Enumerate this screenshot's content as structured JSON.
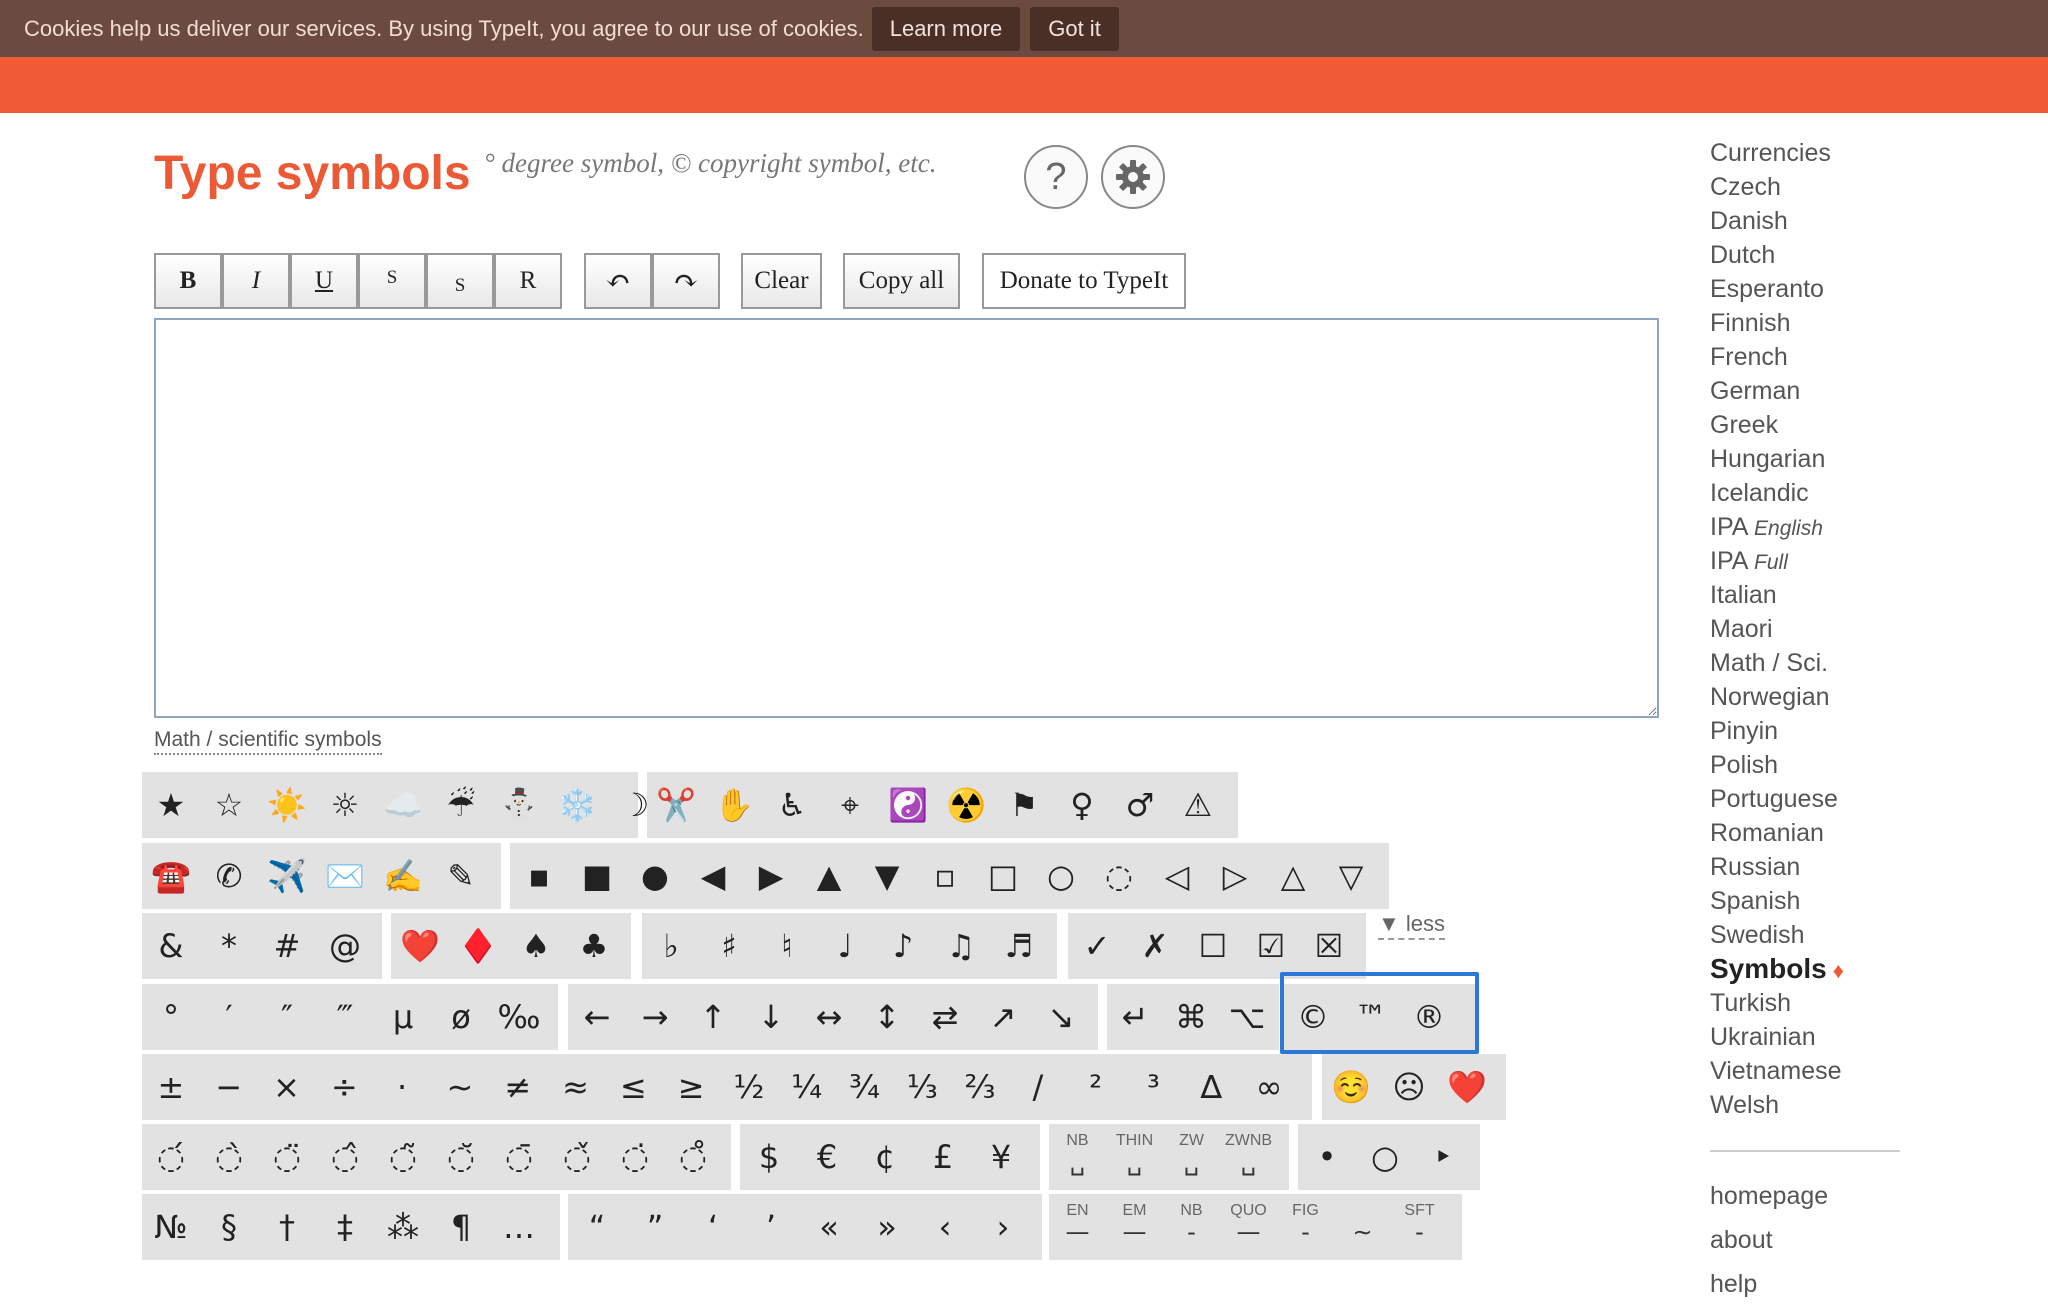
{
  "cookie": {
    "text": "Cookies help us deliver our services. By using TypeIt, you agree to our use of cookies.",
    "learn_more": "Learn more",
    "got_it": "Got it"
  },
  "header": {
    "title": "Type symbols",
    "subtitle": "° degree symbol, © copyright symbol, etc.",
    "help_label": "?",
    "settings_label": "⚙"
  },
  "toolbar": {
    "bold": "B",
    "italic": "I",
    "underline": "U",
    "superscript": "S",
    "subscript": "S",
    "reset": "R",
    "undo": "↶",
    "redo": "↷",
    "clear": "Clear",
    "copy_all": "Copy all",
    "donate": "Donate to TypeIt"
  },
  "editor": {
    "value": ""
  },
  "section": {
    "label": "Math / scientific symbols",
    "less": "▼ less"
  },
  "keyboard": {
    "row1a": [
      "★",
      "☆",
      "☀️",
      "☼",
      "☁️",
      "☔",
      "⛄",
      "❄️",
      "☽"
    ],
    "row1b": [
      "✂️",
      "✋",
      "♿",
      "⌖",
      "☯️",
      "☢️",
      "⚑",
      "♀",
      "♂",
      "⚠"
    ],
    "row2a": [
      "☎️",
      "✆",
      "✈️",
      "✉️",
      "✍️",
      "✎"
    ],
    "row2b": [
      "▪",
      "■",
      "●",
      "◀",
      "▶",
      "▲",
      "▼",
      "▫",
      "□",
      "○",
      "◌",
      "◁",
      "▷",
      "△",
      "▽"
    ],
    "row3a": [
      "&",
      "*",
      "#",
      "@"
    ],
    "row3b": [
      "❤️",
      "♦️",
      "♠",
      "♣"
    ],
    "row3c": [
      "♭",
      "♯",
      "♮",
      "♩",
      "♪",
      "♫",
      "♬"
    ],
    "row3d": [
      "✓",
      "✗",
      "☐",
      "☑",
      "☒"
    ],
    "row4a": [
      "°",
      "′",
      "″",
      "‴",
      "μ",
      "ø",
      "‰"
    ],
    "row4b": [
      "←",
      "→",
      "↑",
      "↓",
      "↔",
      "↕",
      "⇄",
      "↗",
      "↘"
    ],
    "row4c": [
      "↵",
      "⌘",
      "⌥"
    ],
    "row4d": [
      "©",
      "™",
      "®"
    ],
    "row5a": [
      "±",
      "−",
      "×",
      "÷",
      "·",
      "∼",
      "≠",
      "≈",
      "≤",
      "≥",
      "½",
      "¼",
      "¾",
      "⅓",
      "⅔",
      "/",
      "²",
      "³",
      "∆",
      "∞"
    ],
    "row5b": [
      "☺️",
      "☹",
      "❤️"
    ],
    "row6a": [
      "◌́",
      "◌̀",
      "◌̈",
      "◌̂",
      "◌̃",
      "◌̆",
      "◌̄",
      "◌̌",
      "◌̇",
      "◌̊"
    ],
    "row6b": [
      "$",
      "€",
      "¢",
      "£",
      "¥"
    ],
    "row6c": [
      {
        "label": "NB",
        "glyph": "␣"
      },
      {
        "label": "THIN",
        "glyph": "␣"
      },
      {
        "label": "ZW",
        "glyph": "␣"
      },
      {
        "label": "ZWNB",
        "glyph": "␣"
      }
    ],
    "row6d": [
      "•",
      "○",
      "‣"
    ],
    "row7a": [
      "№",
      "§",
      "†",
      "‡",
      "⁂",
      "¶",
      "…"
    ],
    "row7b": [
      "“",
      "”",
      "‘",
      "’",
      "«",
      "»",
      "‹",
      "›"
    ],
    "row7c": [
      {
        "label": "EN",
        "glyph": "—"
      },
      {
        "label": "EM",
        "glyph": "—"
      },
      {
        "label": "NB",
        "glyph": "-"
      },
      {
        "label": "QUO",
        "glyph": "—"
      },
      {
        "label": "FIG",
        "glyph": "-"
      },
      {
        "label": "",
        "glyph": "∼"
      },
      {
        "label": "SFT",
        "glyph": "-"
      }
    ]
  },
  "sidebar": {
    "languages": [
      "Currencies",
      "Czech",
      "Danish",
      "Dutch",
      "Esperanto",
      "Finnish",
      "French",
      "German",
      "Greek",
      "Hungarian",
      "Icelandic"
    ],
    "ipa_english": {
      "main": "IPA",
      "sub": "English"
    },
    "ipa_full": {
      "main": "IPA",
      "sub": "Full"
    },
    "languages2": [
      "Italian",
      "Maori",
      "Math / Sci.",
      "Norwegian",
      "Pinyin",
      "Polish",
      "Portuguese",
      "Romanian",
      "Russian",
      "Spanish",
      "Swedish"
    ],
    "active": "Symbols",
    "active_mark": "♦",
    "languages3": [
      "Turkish",
      "Ukrainian",
      "Vietnamese",
      "Welsh"
    ],
    "links": [
      "homepage",
      "about",
      "help"
    ]
  }
}
